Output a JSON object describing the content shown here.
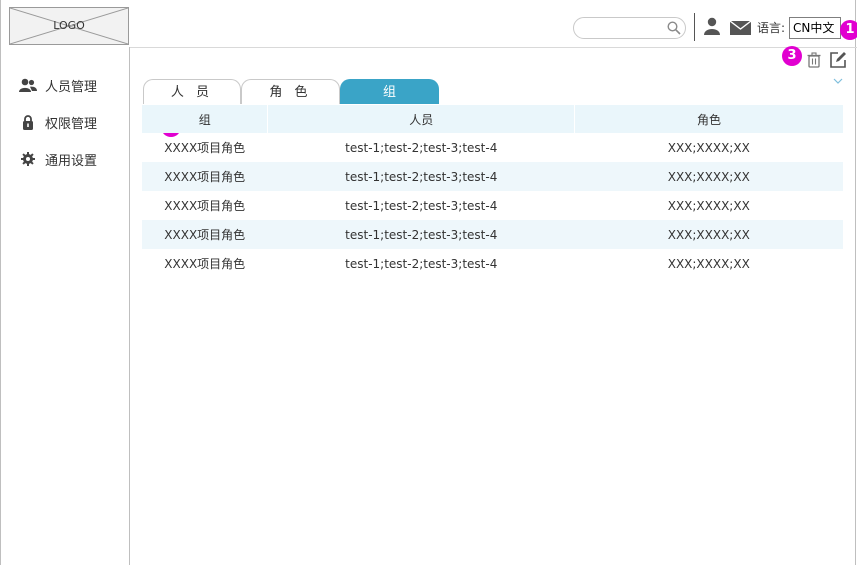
{
  "header": {
    "logo_text": "LOGO",
    "language_label": "语言:",
    "language_value": "CN中文",
    "search_placeholder": ""
  },
  "sidebar": {
    "items": [
      {
        "label": "人员管理",
        "icon": "users-icon"
      },
      {
        "label": "权限管理",
        "icon": "lock-icon"
      },
      {
        "label": "通用设置",
        "icon": "gear-icon"
      }
    ]
  },
  "tabs": [
    {
      "label": "人 员",
      "active": false
    },
    {
      "label": "角 色",
      "active": false
    },
    {
      "label": "组",
      "active": true
    }
  ],
  "toolbar": {
    "delete_icon": "trash-icon",
    "edit_icon": "edit-icon",
    "expand_icon": "chevron-down-icon"
  },
  "annotations": [
    "1",
    "2",
    "3"
  ],
  "table": {
    "columns": [
      "组",
      "人员",
      "角色"
    ],
    "rows": [
      [
        "XXXX项目角色",
        "test-1;test-2;test-3;test-4",
        "XXX;XXXX;XX"
      ],
      [
        "XXXX项目角色",
        "test-1;test-2;test-3;test-4",
        "XXX;XXXX;XX"
      ],
      [
        "XXXX项目角色",
        "test-1;test-2;test-3;test-4",
        "XXX;XXXX;XX"
      ],
      [
        "XXXX项目角色",
        "test-1;test-2;test-3;test-4",
        "XXX;XXXX;XX"
      ],
      [
        "XXXX项目角色",
        "test-1;test-2;test-3;test-4",
        "XXX;XXXX;XX"
      ]
    ]
  },
  "colors": {
    "accent": "#3aa4c7",
    "annotation": "#e100d0",
    "row_stripe": "#eef7fb"
  }
}
